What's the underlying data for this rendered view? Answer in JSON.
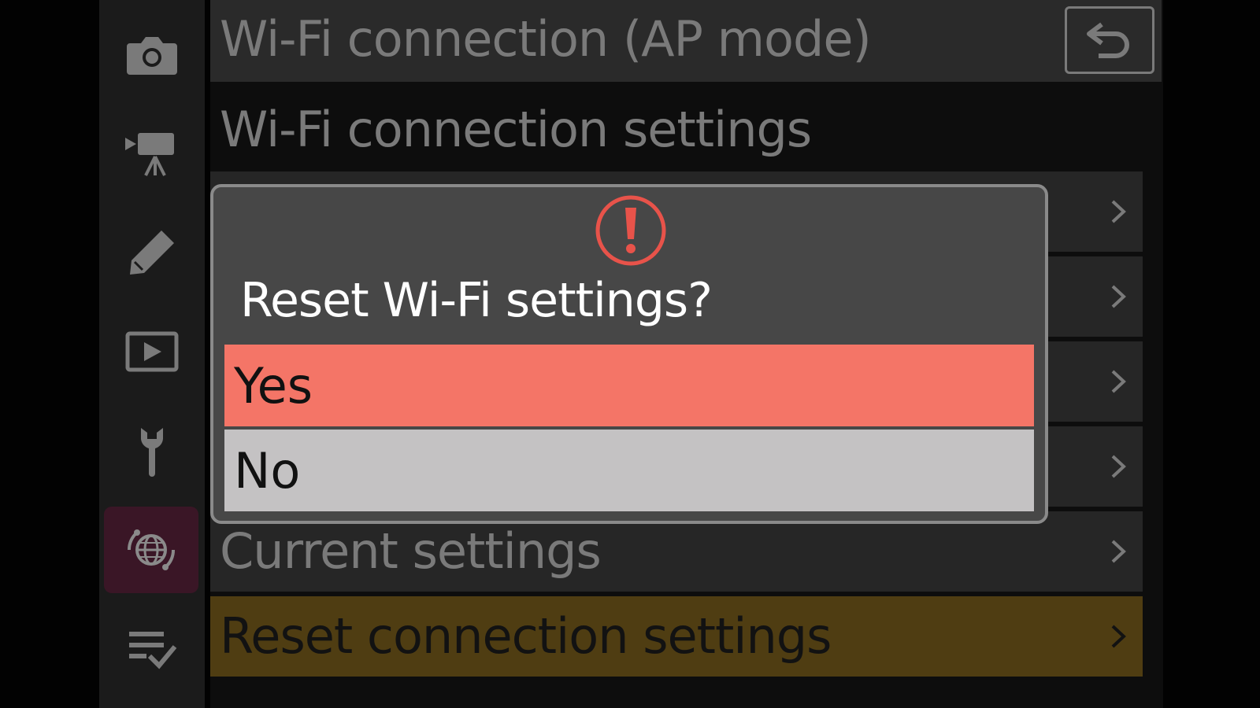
{
  "header": {
    "title": "Wi-Fi connection (AP mode)",
    "back_icon": "back-arrow-icon"
  },
  "section": {
    "title": "Wi-Fi connection settings"
  },
  "sidebar": {
    "items": [
      {
        "icon": "camera-icon",
        "active": false
      },
      {
        "icon": "movie-camera-icon",
        "active": false
      },
      {
        "icon": "pencil-icon",
        "active": false
      },
      {
        "icon": "playback-icon",
        "active": false
      },
      {
        "icon": "wrench-icon",
        "active": false
      },
      {
        "icon": "network-globe-icon",
        "active": true
      },
      {
        "icon": "my-menu-icon",
        "active": false
      }
    ]
  },
  "menu": {
    "items": [
      {
        "label": "",
        "has_arrow": true
      },
      {
        "label": "",
        "has_arrow": true
      },
      {
        "label": "",
        "has_arrow": true
      },
      {
        "label": "",
        "has_arrow": true
      },
      {
        "label": "Current settings",
        "has_arrow": true
      },
      {
        "label": "Reset connection settings",
        "has_arrow": true,
        "highlighted": true
      }
    ]
  },
  "dialog": {
    "icon": "warning-icon",
    "question": "Reset Wi-Fi settings?",
    "options": [
      {
        "label": "Yes",
        "selected": true
      },
      {
        "label": "No",
        "selected": false
      }
    ]
  },
  "colors": {
    "highlight_orange": "#f47567",
    "row_highlight": "#4f3d12",
    "active_tab": "#3a1626",
    "warning_red": "#e8534a"
  }
}
